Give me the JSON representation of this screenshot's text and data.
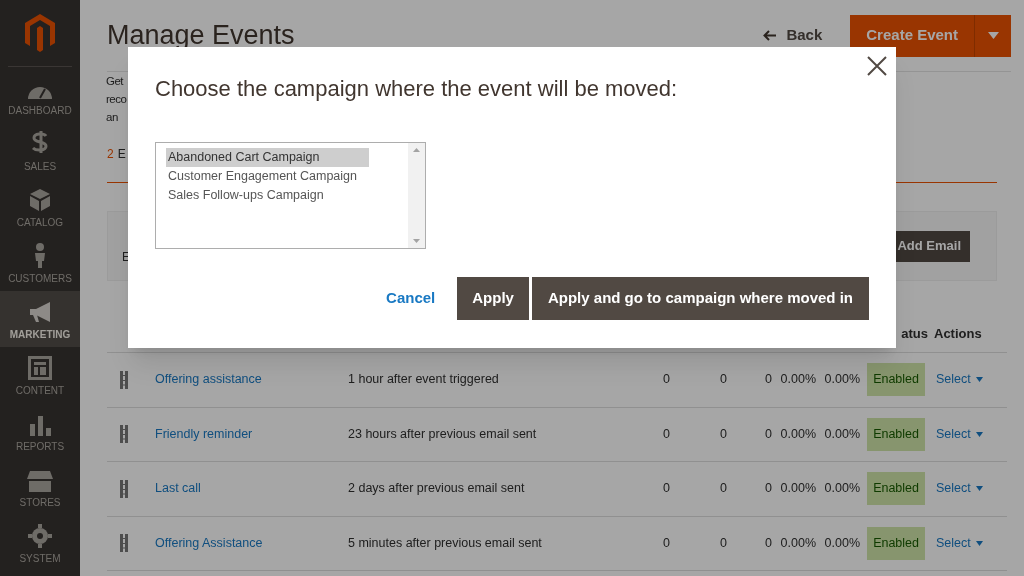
{
  "sidebar": {
    "items": [
      {
        "label": "DASHBOARD",
        "selected": false
      },
      {
        "label": "SALES",
        "selected": false
      },
      {
        "label": "CATALOG",
        "selected": false
      },
      {
        "label": "CUSTOMERS",
        "selected": false
      },
      {
        "label": "MARKETING",
        "selected": true
      },
      {
        "label": "CONTENT",
        "selected": false
      },
      {
        "label": "REPORTS",
        "selected": false
      },
      {
        "label": "STORES",
        "selected": false
      },
      {
        "label": "SYSTEM",
        "selected": false
      }
    ]
  },
  "header": {
    "title": "Manage Events",
    "back_link": "Back",
    "create_button": "Create Event"
  },
  "intro_fragments": [
    "Get",
    "reco",
    "an"
  ],
  "events_summary": {
    "count": "2",
    "label": "E"
  },
  "panel": {
    "subtitle": "E",
    "add_button": "Add Email"
  },
  "table": {
    "columns": [
      "atus",
      "Actions"
    ],
    "rows": [
      {
        "name": "Offering assistance",
        "timing": "1 hour after event triggered",
        "column_3": "0",
        "column_4": "0",
        "column_5": "0",
        "column_6": "0.00%",
        "column_7": "0.00%",
        "status": "Enabled",
        "action": "Select"
      },
      {
        "name": "Friendly reminder",
        "timing": "23 hours after previous email sent",
        "column_3": "0",
        "column_4": "0",
        "column_5": "0",
        "column_6": "0.00%",
        "column_7": "0.00%",
        "status": "Enabled",
        "action": "Select"
      },
      {
        "name": "Last call",
        "timing": "2 days after previous email sent",
        "column_3": "0",
        "column_4": "0",
        "column_5": "0",
        "column_6": "0.00%",
        "column_7": "0.00%",
        "status": "Enabled",
        "action": "Select"
      },
      {
        "name": "Offering Assistance",
        "timing": "5 minutes after previous email sent",
        "column_3": "0",
        "column_4": "0",
        "column_5": "0",
        "column_6": "0.00%",
        "column_7": "0.00%",
        "status": "Enabled",
        "action": "Select"
      }
    ]
  },
  "modal": {
    "title": "Choose the campaign where the event will be moved:",
    "options": [
      {
        "label": "Abandoned Cart Campaign",
        "selected": true
      },
      {
        "label": "Customer Engagement Campaign",
        "selected": false
      },
      {
        "label": "Sales Follow-ups Campaign",
        "selected": false
      }
    ],
    "cancel": "Cancel",
    "apply": "Apply",
    "apply_go": "Apply and go to campaign where moved in"
  }
}
